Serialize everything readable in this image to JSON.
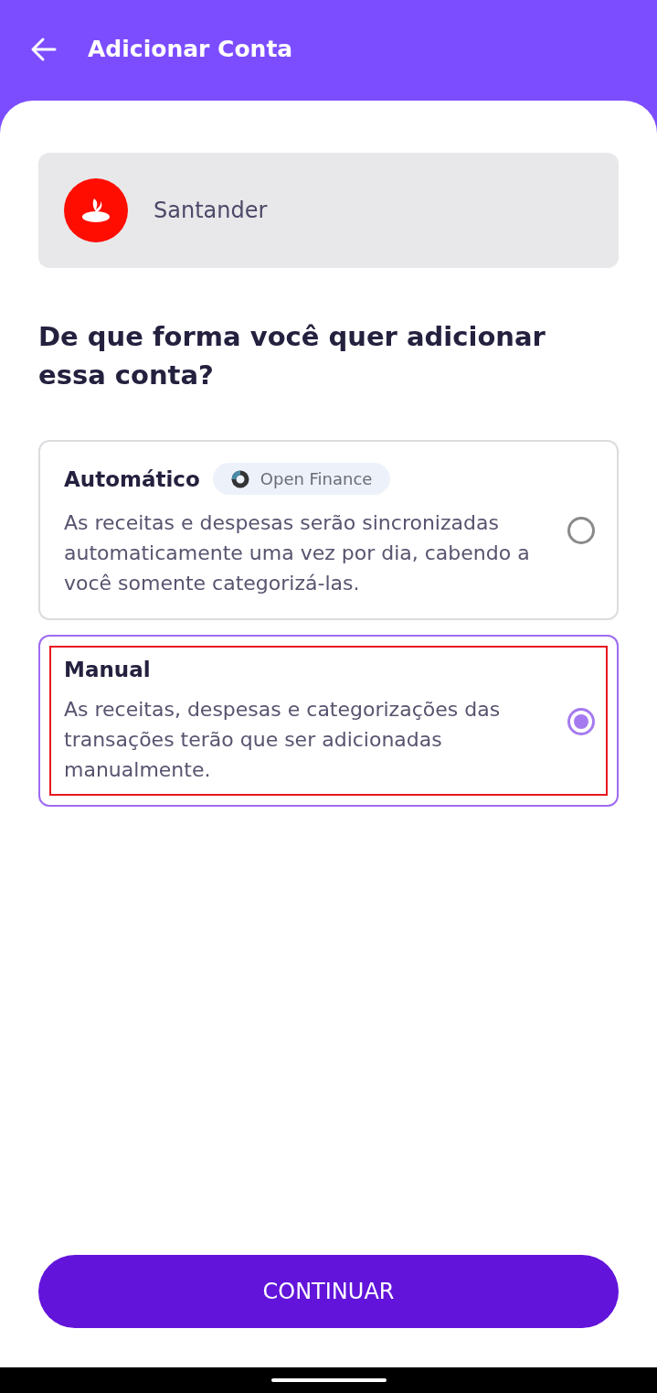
{
  "header": {
    "title": "Adicionar Conta"
  },
  "bank": {
    "name": "Santander"
  },
  "question": "De que forma você quer adicionar essa conta?",
  "options": [
    {
      "title": "Automático",
      "badge": "Open Finance",
      "description": "As receitas e despesas serão sincronizadas automaticamente uma vez por dia, cabendo a você somente categorizá-las.",
      "selected": false,
      "highlighted": false
    },
    {
      "title": "Manual",
      "description": "As receitas, despesas e categorizações das transações terão que ser adicionadas manualmente.",
      "selected": true,
      "highlighted": true
    }
  ],
  "button": "CONTINUAR"
}
